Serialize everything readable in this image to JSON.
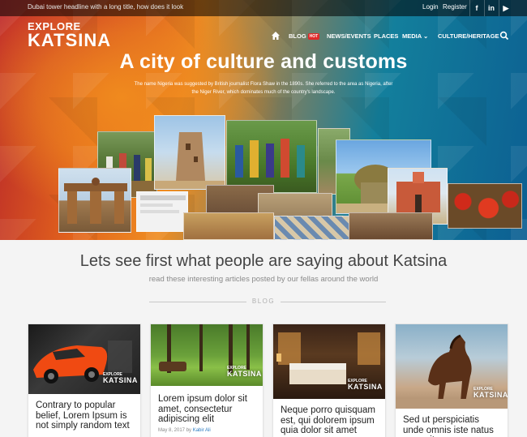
{
  "topbar": {
    "headline": "Dubai tower headline with a long title, how does it look",
    "login": "Login",
    "register": "Register",
    "social": [
      {
        "icon": "facebook-icon",
        "glyph": "f"
      },
      {
        "icon": "linkedin-icon",
        "glyph": "in"
      },
      {
        "icon": "youtube-icon",
        "glyph": "▶"
      }
    ]
  },
  "logo": {
    "line1": "EXPLORE",
    "line2": "KATSINA"
  },
  "nav": {
    "items": [
      {
        "label": "BLOG",
        "badge": "HOT"
      },
      {
        "label": "NEWS/EVENTS"
      },
      {
        "label": "PLACES"
      },
      {
        "label": "MEDIA ⌄"
      },
      {
        "label": "CULTURE/HERITAGE"
      }
    ]
  },
  "hero": {
    "title": "A city of culture and customs",
    "description": "The name Nigeria was suggested by British journalist Flora Shaw in the 1890s. She referred to the area as Nigeria, after the Niger River, which dominates much of the country's landscape."
  },
  "section": {
    "title": "Lets see first what people are saying about Katsina",
    "subtitle": "read these interesting articles posted by our fellas around the world",
    "divider_label": "BLOG"
  },
  "cards": [
    {
      "title": "Contrary to popular belief, Lorem Ipsum is not simply random text",
      "date": "",
      "author": ""
    },
    {
      "title": "Lorem ipsum dolor sit amet, consectetur adipiscing elit",
      "date": "May 8, 2017 by",
      "author": "Kabir Ali"
    },
    {
      "title": "Neque porro quisquam est, qui dolorem ipsum quia dolor sit amet",
      "date": "",
      "author": ""
    },
    {
      "title": "Sed ut perspiciatis unde omnis iste natus error sit",
      "date": "",
      "author": ""
    }
  ],
  "watermark": {
    "line1": "EXPLORE",
    "line2": "KATSINA"
  },
  "colors": {
    "accent_red": "#e02a2a",
    "link_blue": "#2b7bc0"
  }
}
